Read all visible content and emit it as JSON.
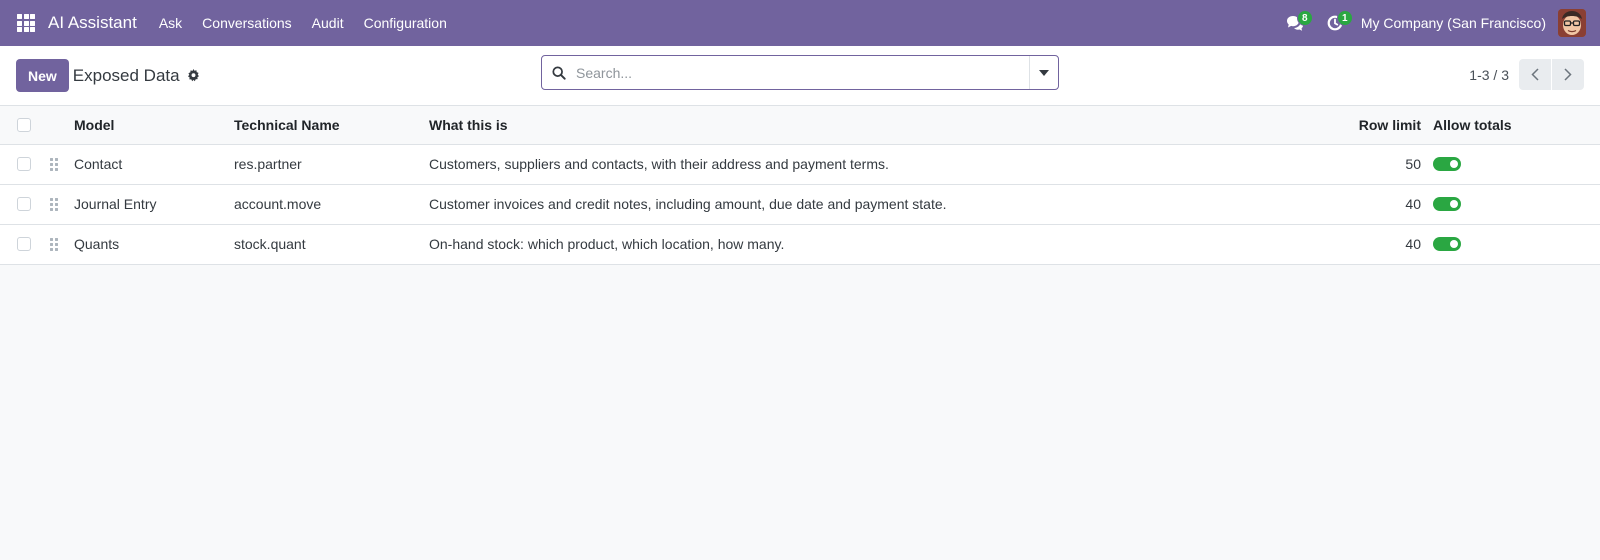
{
  "navbar": {
    "brand": "AI Assistant",
    "menu": [
      "Ask",
      "Conversations",
      "Audit",
      "Configuration"
    ],
    "messages_badge": "8",
    "activity_badge": "1",
    "company": "My Company (San Francisco)"
  },
  "control_panel": {
    "new_label": "New",
    "title": "Exposed Data",
    "search_placeholder": "Search...",
    "pager": "1-3 / 3"
  },
  "table": {
    "headers": {
      "model": "Model",
      "technical_name": "Technical Name",
      "description": "What this is",
      "row_limit": "Row limit",
      "allow_totals": "Allow totals"
    },
    "rows": [
      {
        "model": "Contact",
        "technical_name": "res.partner",
        "description": "Customers, suppliers and contacts, with their address and payment terms.",
        "row_limit": "50",
        "allow_totals": true
      },
      {
        "model": "Journal Entry",
        "technical_name": "account.move",
        "description": "Customer invoices and credit notes, including amount, due date and payment state.",
        "row_limit": "40",
        "allow_totals": true
      },
      {
        "model": "Quants",
        "technical_name": "stock.quant",
        "description": "On-hand stock: which product, which location, how many.",
        "row_limit": "40",
        "allow_totals": true
      }
    ]
  },
  "colors": {
    "primary": "#71639e",
    "toggle_on": "#2aa742"
  }
}
